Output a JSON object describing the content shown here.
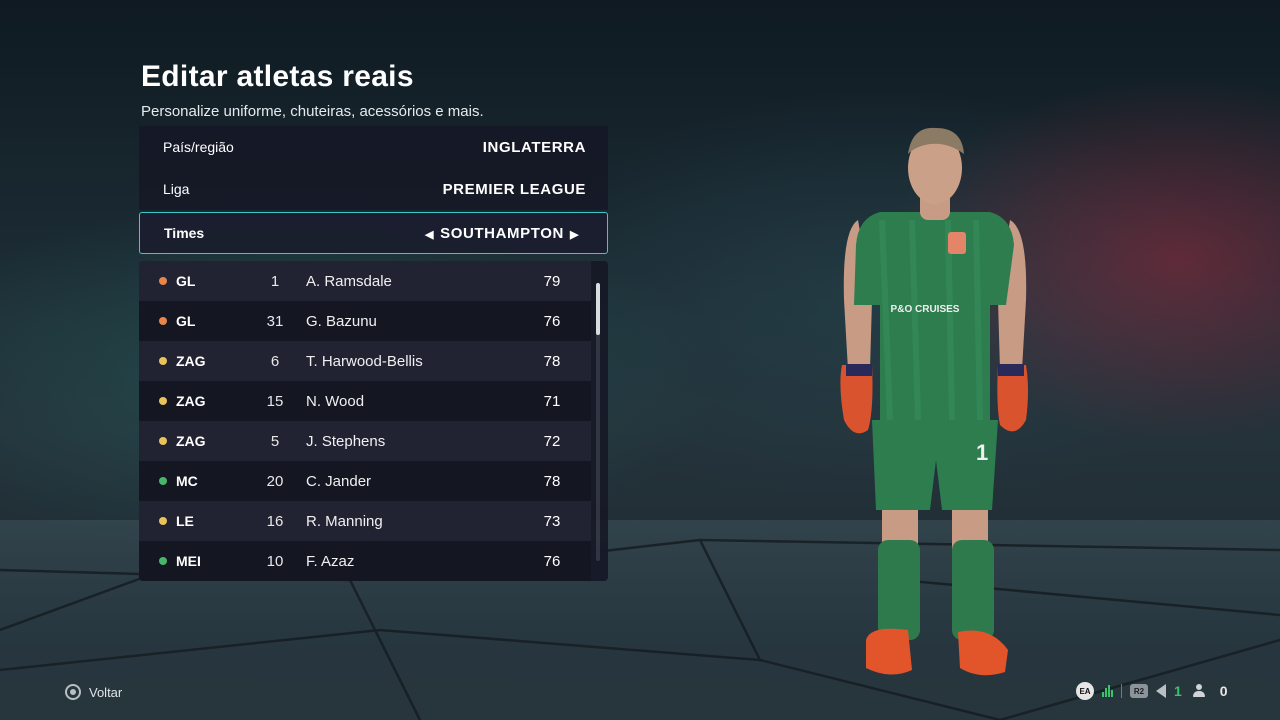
{
  "header": {
    "title": "Editar atletas reais",
    "subtitle": "Personalize uniforme, chuteiras, acessórios e mais."
  },
  "filters": {
    "country": {
      "label": "País/região",
      "value": "INGLATERRA"
    },
    "league": {
      "label": "Liga",
      "value": "PREMIER LEAGUE"
    },
    "team": {
      "label": "Times",
      "value": "SOUTHAMPTON",
      "left_arrow": "◀",
      "right_arrow": "▶"
    }
  },
  "players": [
    {
      "pos": "GL",
      "num": "1",
      "name": "A. Ramsdale",
      "ovr": "79",
      "dot_color": "#e8854a"
    },
    {
      "pos": "GL",
      "num": "31",
      "name": "G. Bazunu",
      "ovr": "76",
      "dot_color": "#e8854a"
    },
    {
      "pos": "ZAG",
      "num": "6",
      "name": "T. Harwood-Bellis",
      "ovr": "78",
      "dot_color": "#e7c35a"
    },
    {
      "pos": "ZAG",
      "num": "15",
      "name": "N. Wood",
      "ovr": "71",
      "dot_color": "#e7c35a"
    },
    {
      "pos": "ZAG",
      "num": "5",
      "name": "J. Stephens",
      "ovr": "72",
      "dot_color": "#e7c35a"
    },
    {
      "pos": "MC",
      "num": "20",
      "name": "C. Jander",
      "ovr": "78",
      "dot_color": "#49b46b"
    },
    {
      "pos": "LE",
      "num": "16",
      "name": "R. Manning",
      "ovr": "73",
      "dot_color": "#e7c35a"
    },
    {
      "pos": "MEI",
      "num": "10",
      "name": "F. Azaz",
      "ovr": "76",
      "dot_color": "#49b46b"
    }
  ],
  "player_model": {
    "sponsor": "P&O CRUISES",
    "shirt_number": "1"
  },
  "footer": {
    "back_label": "Voltar",
    "ea_label": "EA",
    "r2_label": "R2",
    "count_green": "1",
    "count_people": "0"
  },
  "colors": {
    "accent": "#3fc7c9",
    "kit_green": "#2e7d4f",
    "gk_dot": "#e8854a",
    "def_dot": "#e7c35a",
    "mid_dot": "#49b46b"
  }
}
